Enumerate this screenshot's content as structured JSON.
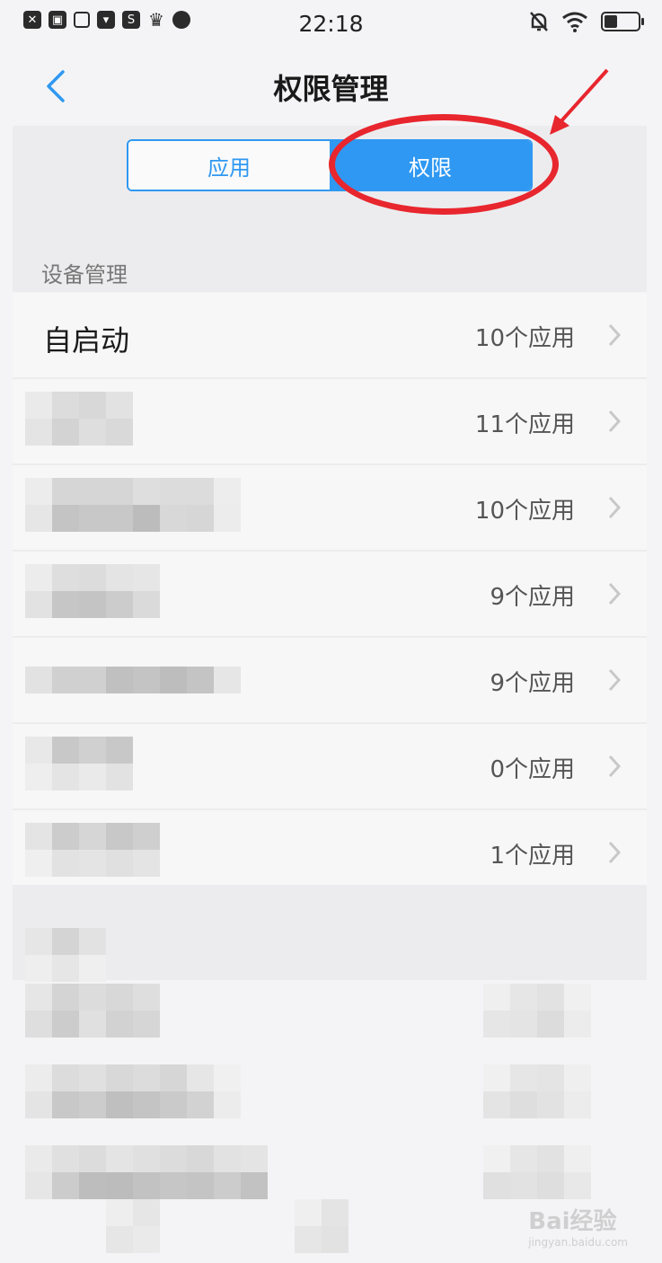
{
  "status_bar": {
    "time": "22:18",
    "left_icons": [
      "close-box-icon",
      "lock-box-icon",
      "search-icon",
      "bag-icon",
      "s-app-icon",
      "crown-icon",
      "chat-bubble-icon"
    ],
    "right_icons": [
      "bell-muted-icon",
      "wifi-icon",
      "battery-icon"
    ],
    "battery_level": 0.4
  },
  "header": {
    "title": "权限管理",
    "back_icon": "chevron-left-icon"
  },
  "segmented": {
    "tabs": [
      {
        "label": "应用",
        "selected": false
      },
      {
        "label": "权限",
        "selected": true
      }
    ]
  },
  "annotation": {
    "color": "#e8262e"
  },
  "section": {
    "title": "设备管理"
  },
  "rows": [
    {
      "name": "自启动",
      "count": "10个应用"
    },
    {
      "name": "",
      "count": "11个应用"
    },
    {
      "name": "",
      "count": "10个应用"
    },
    {
      "name": "",
      "count": "9个应用"
    },
    {
      "name": "",
      "count": "9个应用"
    },
    {
      "name": "",
      "count": "0个应用"
    },
    {
      "name": "",
      "count": "1个应用"
    }
  ],
  "colors": {
    "accent": "#2f98f2",
    "background": "#f4f4f6"
  },
  "watermark": {
    "text": "Bai经验",
    "sub": "jingyan.baidu.com"
  }
}
